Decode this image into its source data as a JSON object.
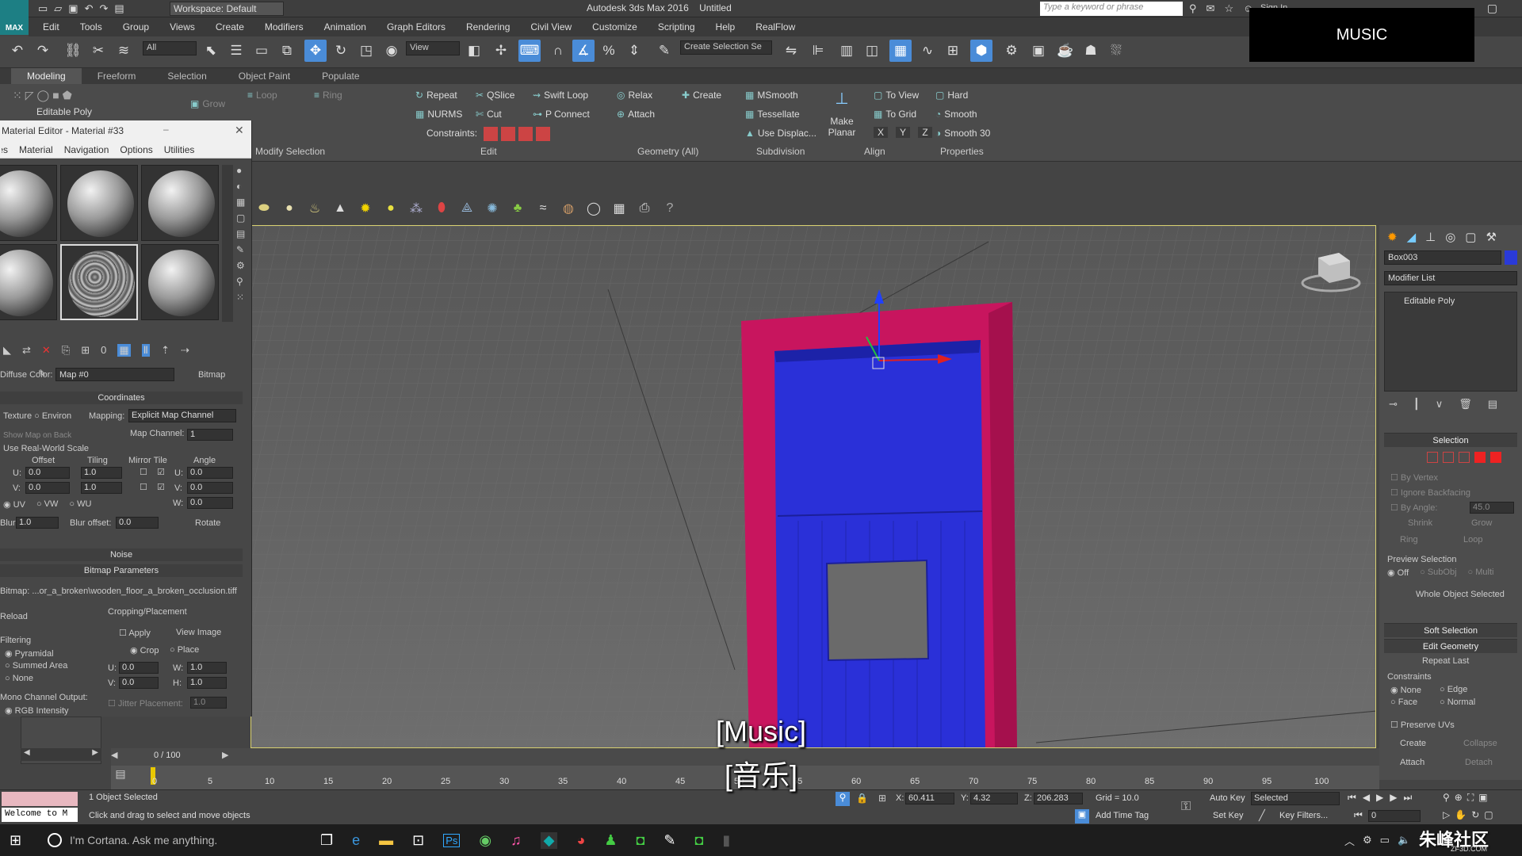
{
  "title_bar": {
    "logo": "MAX",
    "workspace": "Workspace: Default",
    "app_title": "Autodesk 3ds Max 2016",
    "file_title": "Untitled",
    "search_placeholder": "Type a keyword or phrase",
    "sign_in": "Sign In"
  },
  "overlay_label": "MUSIC",
  "menu": [
    "Edit",
    "Tools",
    "Group",
    "Views",
    "Create",
    "Modifiers",
    "Animation",
    "Graph Editors",
    "Rendering",
    "Civil View",
    "Customize",
    "Scripting",
    "Help",
    "RealFlow"
  ],
  "toolbar": {
    "filter": "All",
    "ref_coord": "View",
    "selection_set_placeholder": "Create Selection Se"
  },
  "ribbon": {
    "tabs": [
      "Modeling",
      "Freeform",
      "Selection",
      "Object Paint",
      "Populate"
    ],
    "left_tools": {
      "grow": "Grow",
      "loop": "Loop",
      "ring": "Ring"
    },
    "panel_label": "Editable Poly",
    "modify_selection": "Modify Selection",
    "edit_panel": {
      "repeat": "Repeat",
      "qslice": "QSlice",
      "swift_loop": "Swift Loop",
      "nurms": "NURMS",
      "cut": "Cut",
      "p_connect": "P Connect",
      "constraints": "Constraints:",
      "footer": "Edit"
    },
    "geometry_panel": {
      "relax": "Relax",
      "create": "Create",
      "attach": "Attach",
      "footer": "Geometry (All)"
    },
    "subdivision_panel": {
      "msmooth": "MSmooth",
      "tessellate": "Tessellate",
      "use_displac": "Use Displac...",
      "footer": "Subdivision"
    },
    "align_panel": {
      "make_planar": "Make Planar",
      "to_view": "To View",
      "to_grid": "To Grid",
      "x": "X",
      "y": "Y",
      "z": "Z",
      "footer": "Align"
    },
    "properties_panel": {
      "hard": "Hard",
      "smooth": "Smooth",
      "smooth30": "Smooth 30",
      "footer": "Properties"
    }
  },
  "material_editor": {
    "title": "Material Editor - Material #33",
    "menu": [
      "Modes",
      "Material",
      "Navigation",
      "Options",
      "Utilities"
    ],
    "diffuse_label": "Diffuse Color:",
    "map_name": "Map #0",
    "map_type": "Bitmap",
    "coordinates": {
      "header": "Coordinates",
      "texture": "Texture",
      "environ": "Environ",
      "mapping_label": "Mapping:",
      "mapping_value": "Explicit Map Channel",
      "show_map_on_back": "Show Map on Back",
      "map_channel_label": "Map Channel:",
      "map_channel_value": "1",
      "use_real_world": "Use Real-World Scale",
      "offset": "Offset",
      "tiling": "Tiling",
      "mirror_tile": "Mirror Tile",
      "angle": "Angle",
      "u": "U:",
      "v": "V:",
      "w": "W:",
      "offset_u": "0.0",
      "offset_v": "0.0",
      "tiling_u": "1.0",
      "tiling_v": "1.0",
      "angle_u": "0.0",
      "angle_v": "0.0",
      "angle_w": "0.0",
      "uv": "UV",
      "vw": "VW",
      "wu": "WU",
      "blur_label": "Blur:",
      "blur_value": "1.0",
      "blur_offset_label": "Blur offset:",
      "blur_offset_value": "0.0",
      "rotate": "Rotate"
    },
    "noise": "Noise",
    "bitmap_parameters": "Bitmap Parameters",
    "bitmap_path": "Bitmap: ...or_a_broken\\wooden_floor_a_broken_occlusion.tiff",
    "reload": "Reload",
    "cropping": {
      "header": "Cropping/Placement",
      "apply": "Apply",
      "view_image": "View Image",
      "crop": "Crop",
      "place": "Place",
      "u": "U:",
      "v": "V:",
      "w": "W:",
      "h": "H:",
      "u_val": "0.0",
      "v_val": "0.0",
      "w_val": "1.0",
      "h_val": "1.0",
      "jitter": "Jitter Placement:",
      "jitter_val": "1.0"
    },
    "filtering": {
      "header": "Filtering",
      "pyramidal": "Pyramidal",
      "summed_area": "Summed Area",
      "none": "None"
    },
    "mono_channel": {
      "header": "Mono Channel Output:",
      "rgb": "RGB Intensity"
    }
  },
  "command_panel": {
    "object_name": "Box003",
    "object_color": "#2a3ad8",
    "modifier_list": "Modifier List",
    "stack_item": "Editable Poly",
    "selection": {
      "header": "Selection",
      "by_vertex": "By Vertex",
      "ignore_backfacing": "Ignore Backfacing",
      "by_angle": "By Angle:",
      "angle_value": "45.0",
      "shrink": "Shrink",
      "grow": "Grow",
      "ring": "Ring",
      "loop": "Loop",
      "preview_selection": "Preview Selection",
      "off": "Off",
      "subobj": "SubObj",
      "multi": "Multi",
      "whole_object": "Whole Object Selected"
    },
    "soft_selection": "Soft Selection",
    "edit_geometry": {
      "header": "Edit Geometry",
      "repeat_last": "Repeat Last",
      "constraints": "Constraints",
      "none": "None",
      "edge": "Edge",
      "face": "Face",
      "normal": "Normal",
      "preserve_uvs": "Preserve UVs",
      "create": "Create",
      "collapse": "Collapse",
      "attach": "Attach",
      "detach": "Detach"
    }
  },
  "viewport": {
    "frame_color": "#c8155e",
    "door_color": "#2a30d8"
  },
  "subtitles": {
    "line1": "[Music]",
    "line2": "[音乐]"
  },
  "timeline": {
    "frame_counter": "0 / 100",
    "ticks": [
      "0",
      "5",
      "10",
      "15",
      "20",
      "25",
      "30",
      "35",
      "40",
      "45",
      "50",
      "55",
      "60",
      "65",
      "70",
      "75",
      "80",
      "85",
      "90",
      "95",
      "100"
    ]
  },
  "status": {
    "maxscript": "Welcome to M",
    "objects_selected": "1 Object Selected",
    "hint": "Click and drag to select and move objects",
    "x_label": "X:",
    "x": "60.411",
    "y_label": "Y:",
    "y": "4.32",
    "z_label": "Z:",
    "z": "206.283",
    "grid": "Grid = 10.0",
    "add_time_tag": "Add Time Tag",
    "auto_key": "Auto Key",
    "selected": "Selected",
    "set_key": "Set Key",
    "key_filters": "Key Filters...",
    "frame": "0"
  },
  "taskbar": {
    "cortana": "I'm Cortana. Ask me anything.",
    "watermark": "朱峰社区",
    "watermark_sub": "ZF3D.COM"
  }
}
